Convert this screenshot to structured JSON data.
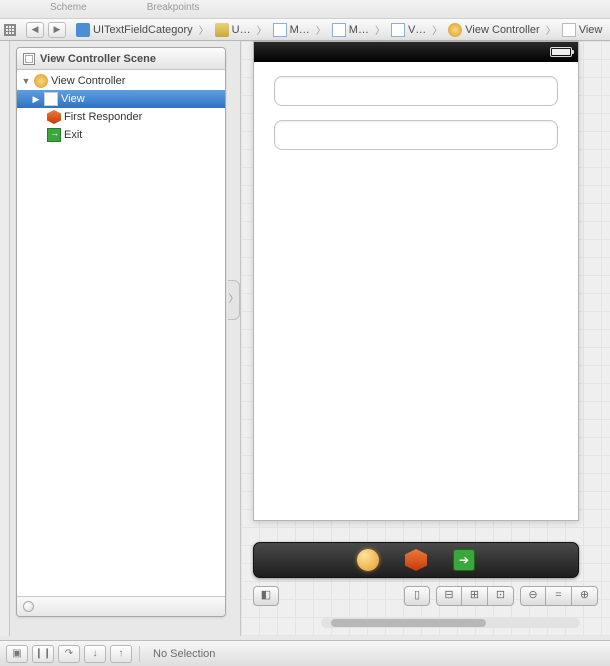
{
  "top_tabs": {
    "scheme": "Scheme",
    "breakpoints": "Breakpoints"
  },
  "breadcrumb": {
    "project": "UITextFieldCategory",
    "folder": "U…",
    "file1": "M…",
    "file2": "M…",
    "file3": "V…",
    "controller": "View Controller",
    "view": "View"
  },
  "outline": {
    "title": "View Controller Scene",
    "nodes": {
      "controller": "View Controller",
      "view": "View",
      "first_responder": "First Responder",
      "exit": "Exit"
    }
  },
  "debug": {
    "status": "No Selection"
  }
}
